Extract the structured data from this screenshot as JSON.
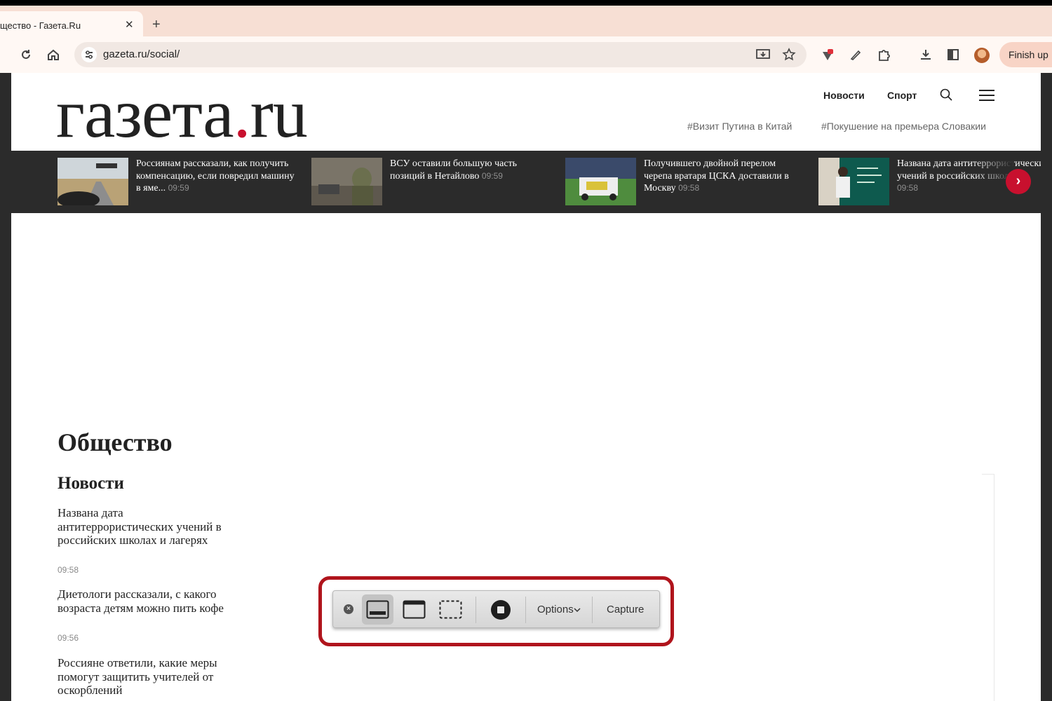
{
  "browser": {
    "tab_title": "щество - Газета.Ru",
    "tab_close": "✕",
    "new_tab": "+",
    "url": "gazeta.ru/social/",
    "finish_button": "Finish up"
  },
  "header": {
    "logo_main": "газета",
    "logo_dot": ".",
    "logo_ru": "ru",
    "nav": [
      "Новости",
      "Спорт"
    ],
    "tags": [
      "#Визит Путина в Китай",
      "#Покушение на премьера Словакии"
    ]
  },
  "strip": {
    "cards": [
      {
        "text": "Россиянам рассказали, как получить компенсацию, если повредил машину в яме...",
        "time": "09:59"
      },
      {
        "text": "ВСУ оставили большую часть позиций в Нетайлово",
        "time": "09:59"
      },
      {
        "text": "Получившего двойной перелом черепа вратаря ЦСКА доставили в Москву",
        "time": "09:58"
      },
      {
        "text": "Названа дата антитеррористических учений в российских школах",
        "time": "09:58"
      }
    ],
    "next": "›"
  },
  "main": {
    "section_title": "Общество",
    "news_heading": "Новости",
    "news": [
      {
        "title": "Названа дата антитеррористических учений в российских школах и лагерях",
        "time": "09:58"
      },
      {
        "title": "Диетологи рассказали, с какого возраста детям можно пить кофе",
        "time": "09:56"
      },
      {
        "title": "Россияне ответили, какие меры помогут защитить учителей от оскорблений",
        "time": ""
      }
    ]
  },
  "capture_bar": {
    "close": "×",
    "options_label": "Options",
    "capture_label": "Capture"
  }
}
